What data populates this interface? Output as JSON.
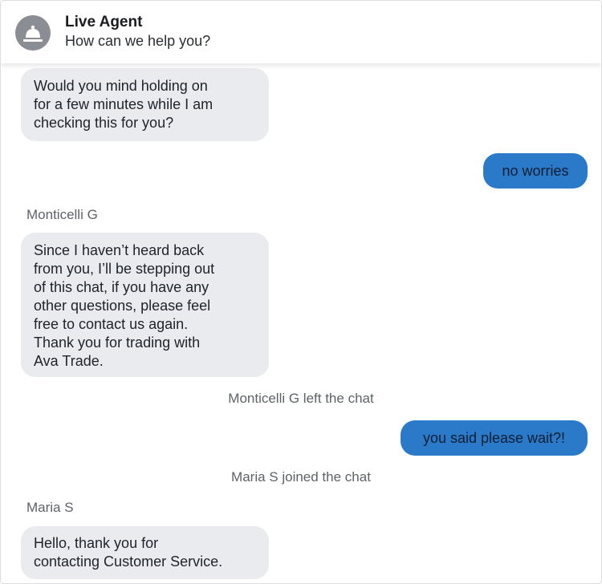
{
  "header": {
    "title": "Live Agent",
    "subtitle": "How can we help you?",
    "icon": "bell-icon"
  },
  "colors": {
    "agent_bubble": "#e9ebef",
    "user_bubble": "#2a7ac9",
    "meta_text": "#5e6269"
  },
  "messages": {
    "m1": {
      "lines": [
        "Would you mind holding on",
        "for a few minutes while I am",
        "checking this for you?"
      ]
    },
    "m2": {
      "text": "no worries"
    },
    "sender1": "Monticelli G",
    "m3": {
      "lines": [
        "Since I haven’t heard back",
        "from you, I’ll be stepping out",
        "of this chat, if you have any",
        "other questions, please feel",
        "free to contact us again.",
        "Thank you for trading with",
        "Ava Trade."
      ]
    },
    "system1": "Monticelli G left the chat",
    "m4": {
      "text": "you said please wait?!"
    },
    "system2": "Maria S joined the chat",
    "sender2": "Maria S",
    "m5": {
      "lines": [
        "Hello, thank you for",
        "contacting Customer Service."
      ]
    }
  }
}
